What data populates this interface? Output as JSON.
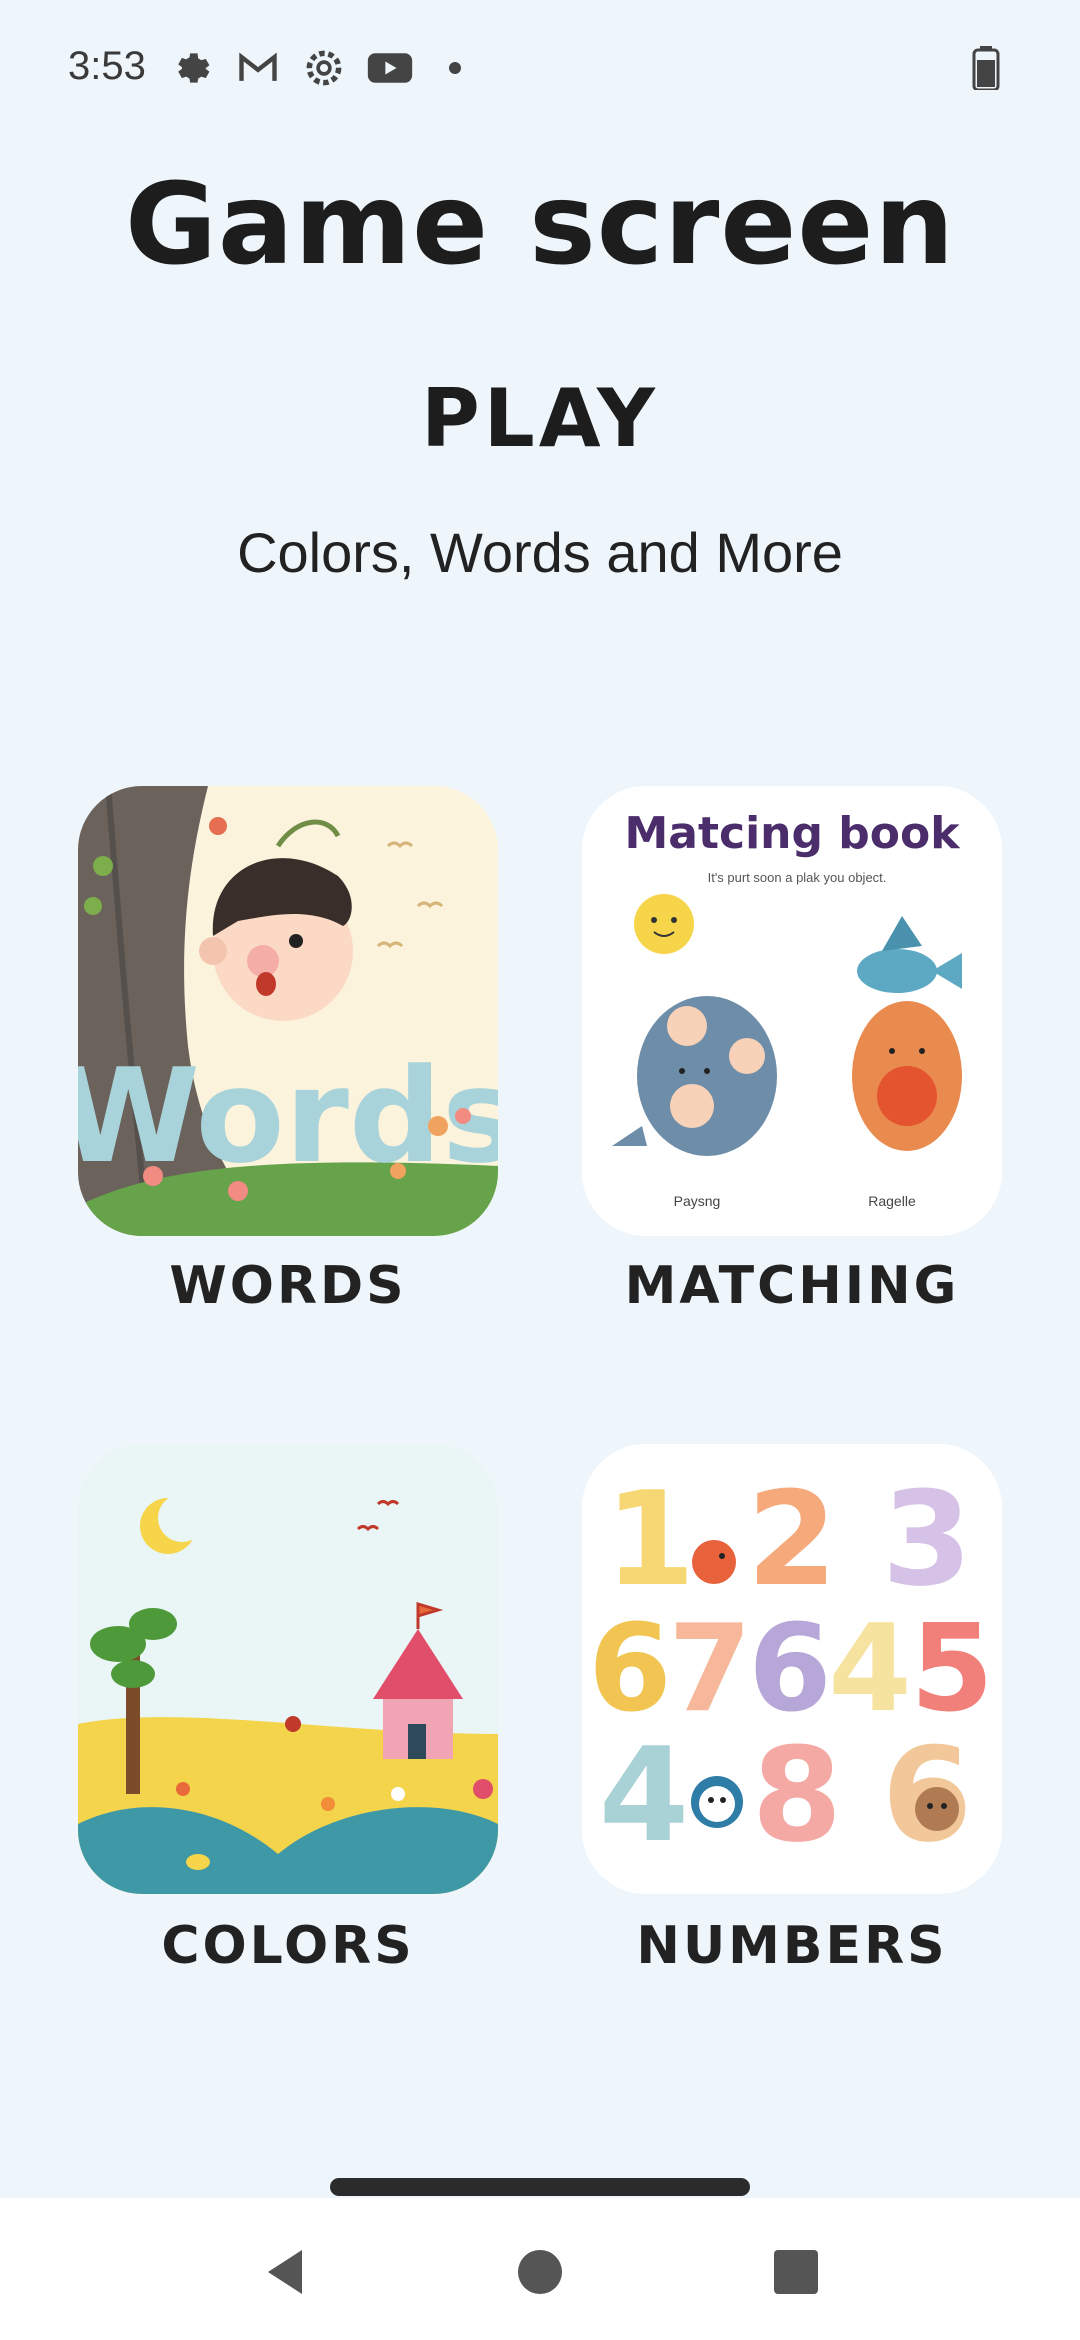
{
  "status_bar": {
    "time": "3:53",
    "icons": [
      "settings-gear-icon",
      "gmail-icon",
      "settings-gear-icon",
      "youtube-icon",
      "notification-dot-icon"
    ],
    "right_icons": [
      "battery-icon"
    ]
  },
  "header": {
    "title": "Game screen",
    "subtitle": "PLAY",
    "tagline": "Colors, Words and More"
  },
  "cards": {
    "words": {
      "label": "WORDS",
      "image_text": "Words"
    },
    "matching": {
      "label": "MATCHING",
      "image_title": "Matcing book",
      "image_caption": "It's purt soon a plak you object.",
      "image_left_name": "Paysng",
      "image_right_name": "Ragelle"
    },
    "colors": {
      "label": "COLORS"
    },
    "numbers": {
      "label": "NUMBERS",
      "digits_row1": [
        "1",
        "2",
        "3"
      ],
      "digits_row2": [
        "6",
        "7",
        "6",
        "4",
        "5"
      ],
      "digits_row3": [
        "4",
        "8",
        "6"
      ]
    }
  },
  "nav": {
    "buttons": [
      "back-icon",
      "home-icon",
      "recents-icon"
    ]
  },
  "colors": {
    "background": "#EEF6FC",
    "text": "#1d1d1d",
    "nav_bar": "#ffffff"
  }
}
